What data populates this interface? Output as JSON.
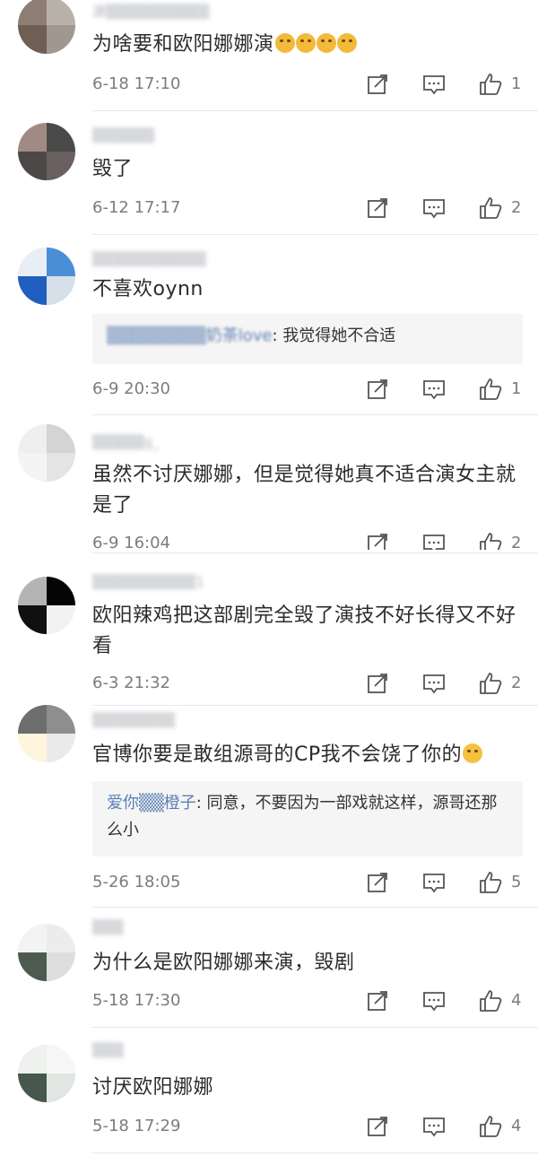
{
  "colors": {
    "text": "#2b2b2b",
    "meta": "#7c7c7c",
    "reply_bg": "#f5f5f5",
    "reply_name": "#5b7fb3",
    "divider": "#e8e8e8"
  },
  "icons": {
    "share": "share-icon",
    "comment": "comment-icon",
    "like": "thumbs-up-icon"
  },
  "comments": [
    {
      "username": "源▒▒▒▒▒▒▒▒▒▒",
      "text": "为啥要和欧阳娜娜演",
      "emoji": "crying-face x4",
      "time": "6-18 17:10",
      "likes": "1"
    },
    {
      "username": "▒▒▒▒▒▒",
      "text": "毁了",
      "time": "6-12 17:17",
      "likes": "2"
    },
    {
      "username": "▒▒▒▒▒▒▒▒▒▒▒",
      "text": "不喜欢oynn",
      "reply": {
        "name": "▒▒▒▒▒▒▒▒奶茶love",
        "text": ": 我觉得她不合适"
      },
      "time": "6-9 20:30",
      "likes": "1"
    },
    {
      "username": "▒▒▒▒▒g_",
      "text": "虽然不讨厌娜娜，但是觉得她真不适合演女主就是了",
      "time": "6-9 16:04",
      "likes": "2"
    },
    {
      "username": "▒▒▒▒▒▒▒▒▒▒1",
      "text": "欧阳辣鸡把这部剧完全毁了演技不好长得又不好看",
      "time": "6-3 21:32",
      "likes": "2"
    },
    {
      "username": "▒▒▒▒▒▒▒▒",
      "text": "官博你要是敢组源哥的CP我不会饶了你的",
      "emoji": "smile",
      "reply": {
        "name": "爱你▒▒橙子",
        "text": ": 同意，不要因为一部戏就这样，源哥还那么小"
      },
      "time": "5-26 18:05",
      "likes": "5"
    },
    {
      "username": "▒▒▒",
      "text": "为什么是欧阳娜娜来演，毁剧",
      "time": "5-18 17:30",
      "likes": "4"
    },
    {
      "username": "▒▒▒",
      "text": "讨厌欧阳娜娜",
      "time": "5-18 17:29",
      "likes": "4"
    }
  ]
}
